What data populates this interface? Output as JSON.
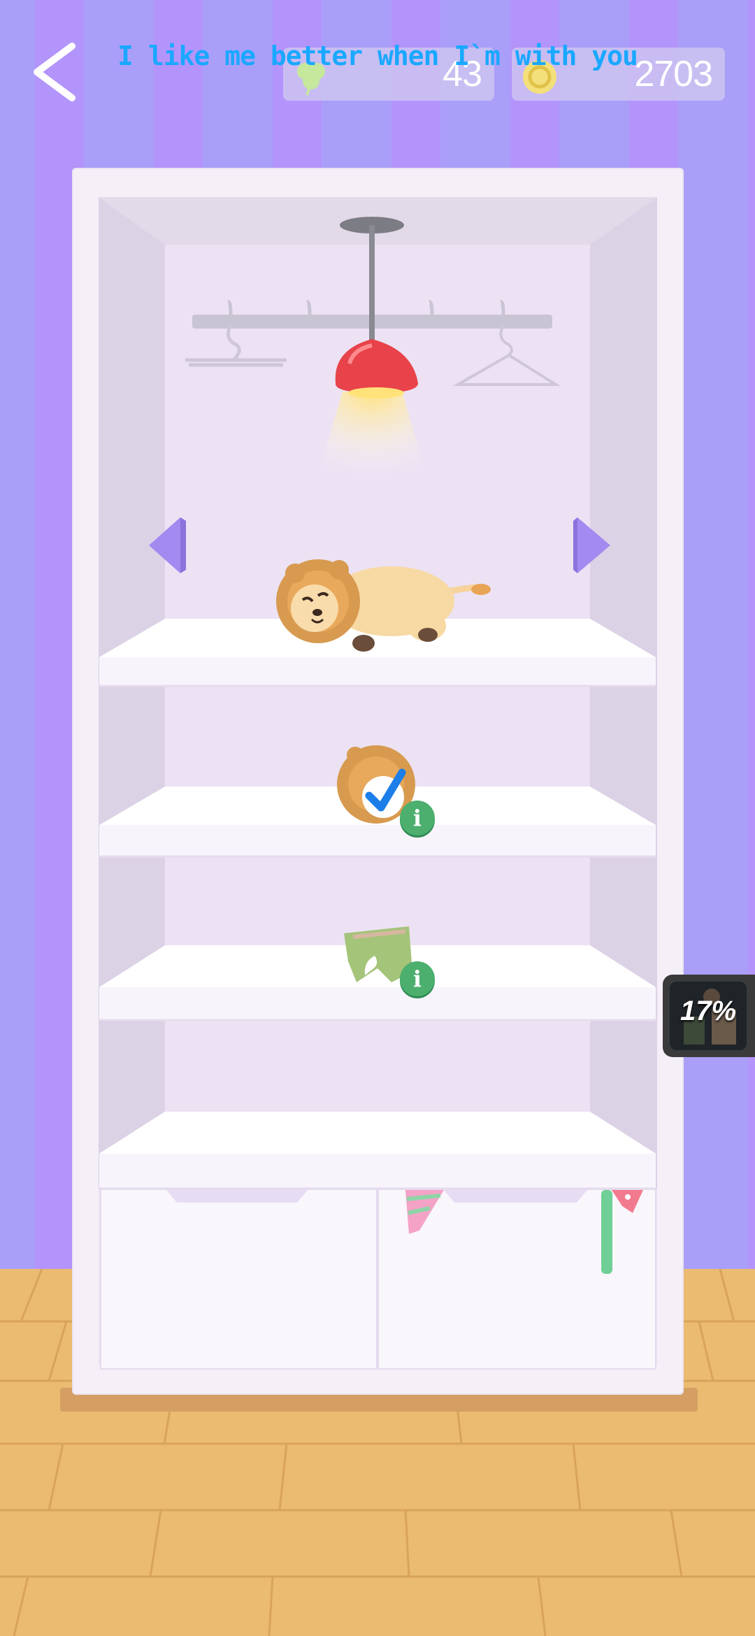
{
  "hud": {
    "back_icon": "chevron-left-icon",
    "clover_count": "43",
    "clover_icon": "clover-icon",
    "coin_count": "2703",
    "coin_icon": "coin-icon",
    "lyric": "I like me better when I`m with you"
  },
  "wardrobe": {
    "prev_icon": "arrow-left-icon",
    "next_icon": "arrow-right-icon",
    "items": [
      {
        "name": "lion-costume",
        "selected": true
      },
      {
        "name": "green-shorts",
        "selected": false
      }
    ]
  },
  "progress_badge": {
    "value": "17%",
    "percent": 17
  },
  "colors": {
    "wall_stripe_a": "#a99ff9",
    "wall_stripe_b": "#b394fb",
    "floor": "#ebbb72",
    "accent_green": "#4caf6e",
    "lamp_red": "#e8434a",
    "lyric_blue": "#1aa8ff"
  }
}
